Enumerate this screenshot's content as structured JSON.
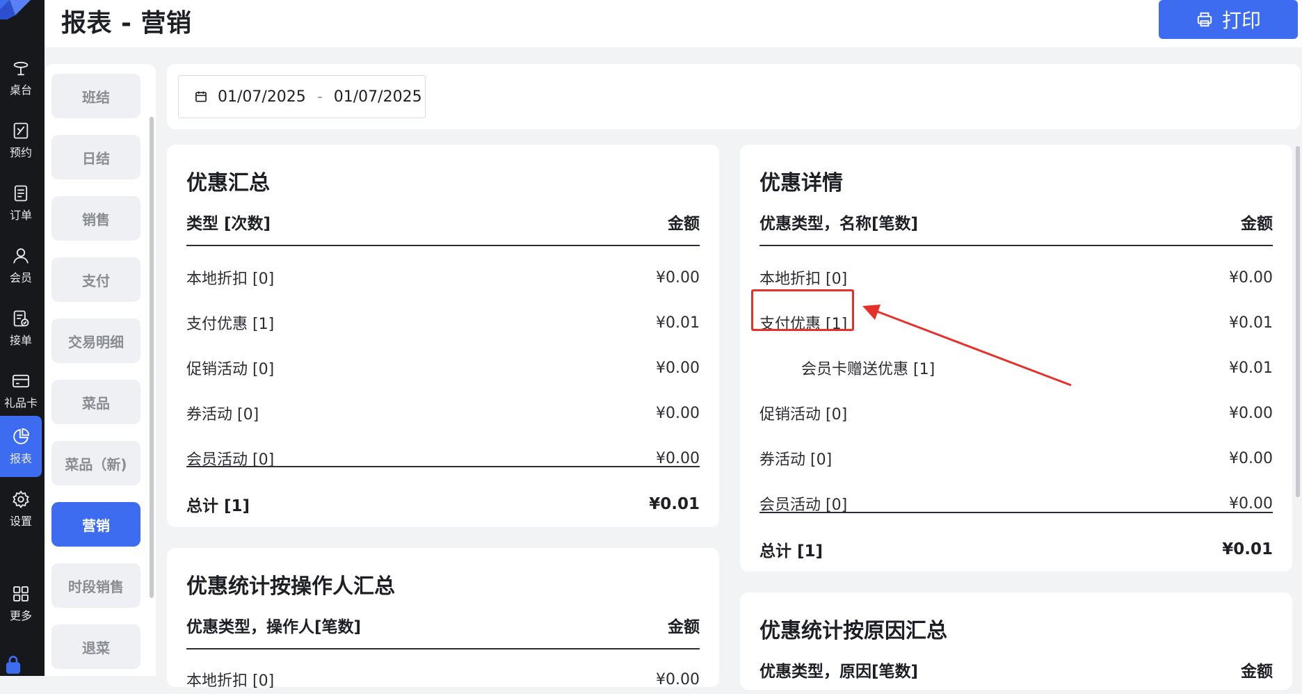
{
  "header": {
    "title": "报表 - 营销",
    "print_label": "打印"
  },
  "nav": {
    "items": [
      {
        "label": "桌台",
        "icon": "table-icon"
      },
      {
        "label": "预约",
        "icon": "reservation-icon"
      },
      {
        "label": "订单",
        "icon": "order-icon"
      },
      {
        "label": "会员",
        "icon": "member-icon"
      },
      {
        "label": "接单",
        "icon": "accept-order-icon"
      },
      {
        "label": "礼品卡",
        "icon": "gift-card-icon"
      },
      {
        "label": "报表",
        "icon": "report-icon",
        "active": true
      },
      {
        "label": "设置",
        "icon": "settings-icon"
      },
      {
        "label": "更多",
        "icon": "grid-icon"
      }
    ]
  },
  "submenu": {
    "items": [
      "班结",
      "日结",
      "销售",
      "支付",
      "交易明细",
      "菜品",
      "菜品（新)",
      "营销",
      "时段销售",
      "退菜"
    ],
    "active": "营销"
  },
  "date_range": {
    "start": "01/07/2025",
    "separator": "-",
    "end": "01/07/2025"
  },
  "discount_summary": {
    "title": "优惠汇总",
    "col_type": "类型 [次数]",
    "col_amount": "金额",
    "rows": [
      {
        "name": "本地折扣 [0]",
        "amount": "¥0.00"
      },
      {
        "name": "支付优惠 [1]",
        "amount": "¥0.01"
      },
      {
        "name": "促销活动 [0]",
        "amount": "¥0.00"
      },
      {
        "name": "券活动 [0]",
        "amount": "¥0.00"
      },
      {
        "name": "会员活动 [0]",
        "amount": "¥0.00"
      }
    ],
    "total": {
      "name": "总计 [1]",
      "amount": "¥0.01"
    }
  },
  "discount_detail": {
    "title": "优惠详情",
    "col_type": "优惠类型，名称[笔数]",
    "col_amount": "金额",
    "rows": [
      {
        "name": "本地折扣 [0]",
        "amount": "¥0.00"
      },
      {
        "name": "支付优惠 [1]",
        "amount": "¥0.01"
      },
      {
        "name": "会员卡赠送优惠 [1]",
        "amount": "¥0.01"
      },
      {
        "name": "促销活动 [0]",
        "amount": "¥0.00"
      },
      {
        "name": "券活动 [0]",
        "amount": "¥0.00"
      },
      {
        "name": "会员活动 [0]",
        "amount": "¥0.00"
      }
    ],
    "total": {
      "name": "总计 [1]",
      "amount": "¥0.01"
    }
  },
  "by_operator": {
    "title": "优惠统计按操作人汇总",
    "col_type": "优惠类型，操作人[笔数]",
    "col_amount": "金额",
    "rows": [
      {
        "name": "本地折扣 [0]",
        "amount": "¥0.00"
      }
    ]
  },
  "by_reason": {
    "title": "优惠统计按原因汇总",
    "col_type": "优惠类型，原因[笔数]",
    "col_amount": "金额"
  },
  "colors": {
    "accent": "#3d6cf0",
    "annotation": "#e8302b",
    "rail": "#17181c"
  }
}
